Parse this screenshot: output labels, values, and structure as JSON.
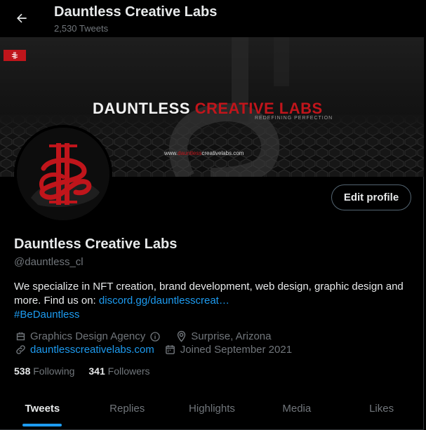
{
  "header": {
    "title": "Dauntless Creative Labs",
    "subtitle": "2,530 Tweets",
    "back_icon": "arrow-left-icon"
  },
  "banner": {
    "title_white": "DAUNTLESS ",
    "title_red": "CREATIVE LABS",
    "tagline": "REDEFINING PERFECTION",
    "url_prefix": "www.",
    "url_red": "dauntless",
    "url_suffix": "creativelabs.com",
    "brand_color": "#c0151b"
  },
  "profile": {
    "edit_label": "Edit profile",
    "name": "Dauntless Creative Labs",
    "handle": "@dauntless_cl",
    "bio_text": "We specialize in NFT creation, brand development, web design, graphic design and more. Find us on: ",
    "bio_link": "discord.gg/dauntlesscreat…",
    "bio_hashtag": "#BeDauntless",
    "category": "Graphics Design Agency",
    "location": "Surprise, Arizona",
    "website": "dauntlesscreativelabs.com",
    "joined": "Joined September 2021",
    "following_count": "538",
    "following_label": "Following",
    "followers_count": "341",
    "followers_label": "Followers"
  },
  "tabs": [
    {
      "label": "Tweets",
      "active": true
    },
    {
      "label": "Replies",
      "active": false
    },
    {
      "label": "Highlights",
      "active": false
    },
    {
      "label": "Media",
      "active": false
    },
    {
      "label": "Likes",
      "active": false
    }
  ],
  "colors": {
    "accent": "#1d9bf0",
    "text": "#e7e9ea",
    "muted": "#71767b",
    "background": "#000000"
  }
}
